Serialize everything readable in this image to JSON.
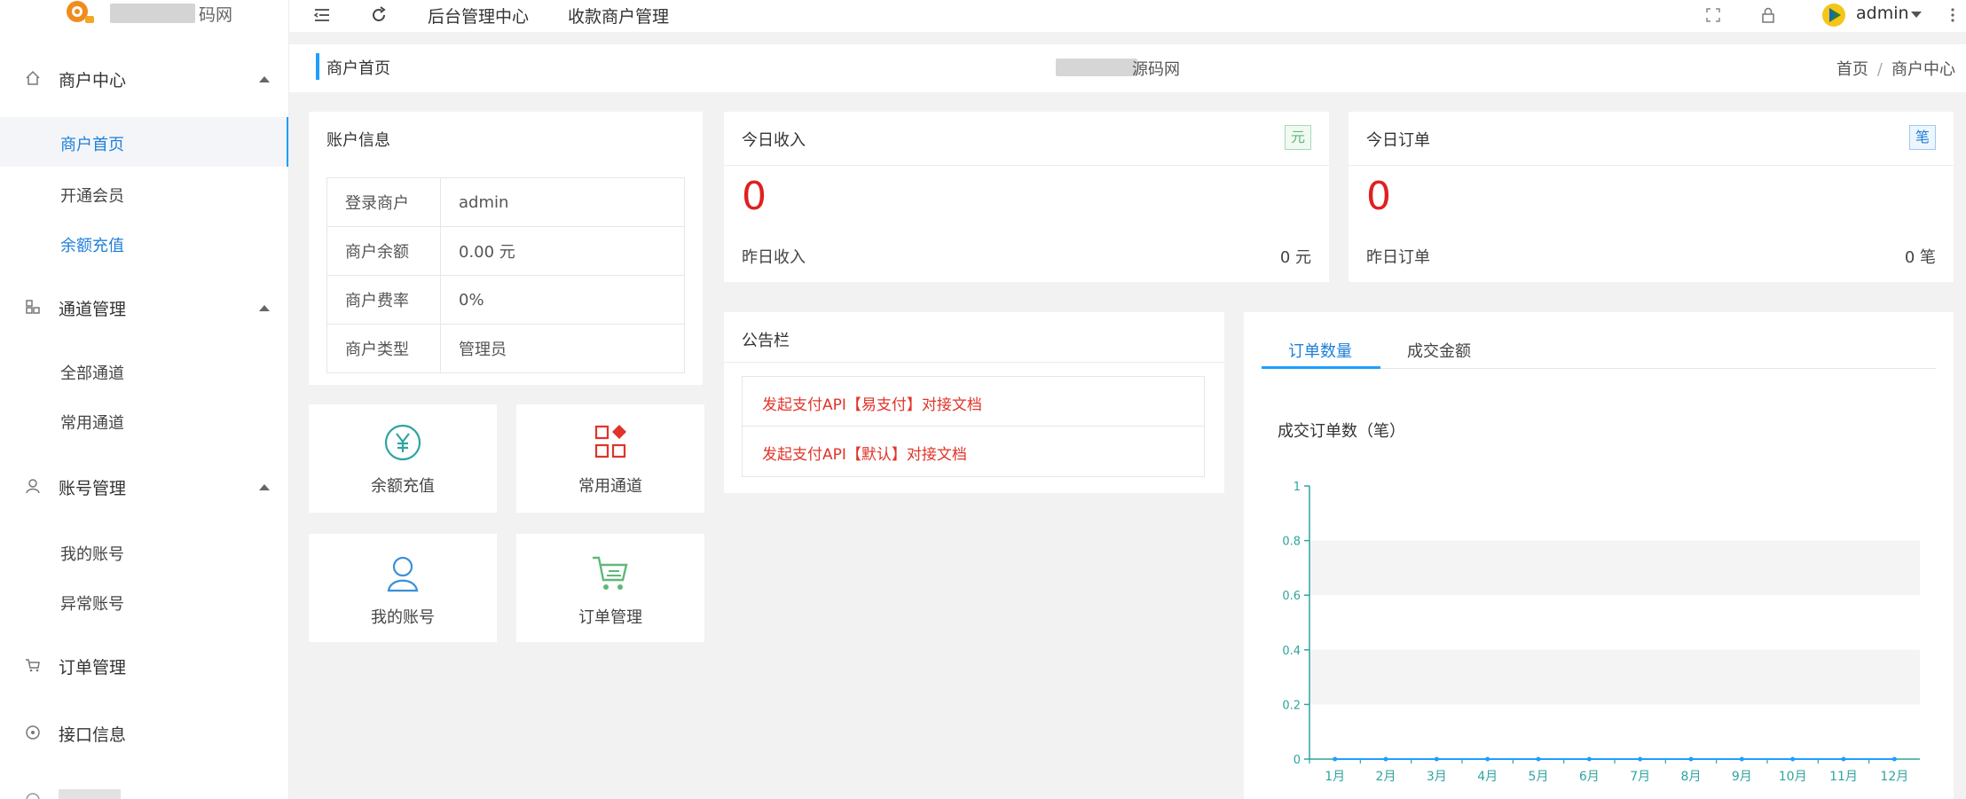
{
  "brand": {
    "name_suffix": "码网"
  },
  "sidebar": {
    "groups": [
      {
        "label": "商户中心",
        "items": [
          "商户首页",
          "开通会员",
          "余额充值"
        ]
      },
      {
        "label": "通道管理",
        "items": [
          "全部通道",
          "常用通道"
        ]
      },
      {
        "label": "账号管理",
        "items": [
          "我的账号",
          "异常账号"
        ]
      },
      {
        "label": "订单管理"
      },
      {
        "label": "接口信息"
      }
    ]
  },
  "header": {
    "links": [
      "后台管理中心",
      "收款商户管理"
    ],
    "user": "admin"
  },
  "breadcrumb": {
    "page": "商户首页",
    "site_suffix": "源码网",
    "trail": [
      "首页",
      "商户中心"
    ]
  },
  "account": {
    "title": "账户信息",
    "rows": [
      {
        "key": "登录商户",
        "value": "admin"
      },
      {
        "key": "商户余额",
        "value": "0.00 元"
      },
      {
        "key": "商户费率",
        "value": "0%"
      },
      {
        "key": "商户类型",
        "value": "管理员"
      }
    ]
  },
  "quick_links": [
    {
      "label": "余额充值"
    },
    {
      "label": "常用通道"
    },
    {
      "label": "我的账号"
    },
    {
      "label": "订单管理"
    }
  ],
  "income": {
    "title": "今日收入",
    "tag": "元",
    "value": "0",
    "sub_label": "昨日收入",
    "sub_value": "0 元"
  },
  "orders": {
    "title": "今日订单",
    "tag": "笔",
    "value": "0",
    "sub_label": "昨日订单",
    "sub_value": "0 笔"
  },
  "notice": {
    "title": "公告栏",
    "items": [
      "发起支付API【易支付】对接文档",
      "发起支付API【默认】对接文档"
    ]
  },
  "chart_panel": {
    "tabs": [
      "订单数量",
      "成交金额"
    ],
    "chart_title": "成交订单数（笔）"
  },
  "colors": {
    "accent": "#1e9fff",
    "danger": "#e02020",
    "axis": "#2fa4a0",
    "income_tag": "#5fb878"
  },
  "chart_data": {
    "type": "line",
    "categories": [
      "1月",
      "2月",
      "3月",
      "4月",
      "5月",
      "6月",
      "7月",
      "8月",
      "9月",
      "10月",
      "11月",
      "12月"
    ],
    "series": [
      {
        "values": [
          0,
          0,
          0,
          0,
          0,
          0,
          0,
          0,
          0,
          0,
          0,
          0
        ]
      }
    ],
    "y_ticks": [
      "0",
      "0.2",
      "0.4",
      "0.6",
      "0.8",
      "1"
    ],
    "ylim": [
      0,
      1
    ],
    "grid": true
  }
}
